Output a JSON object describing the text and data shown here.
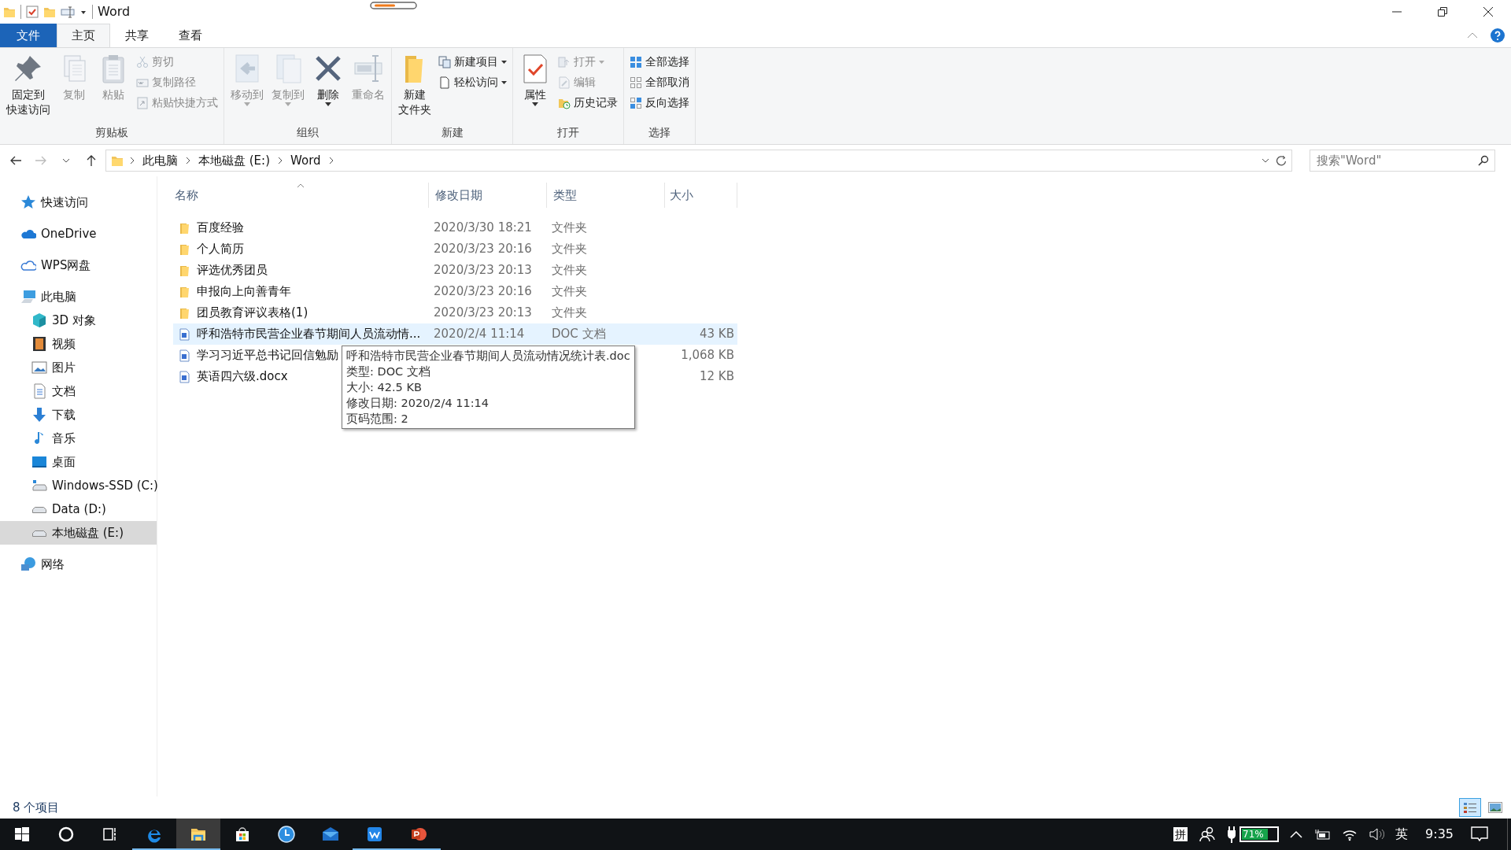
{
  "window": {
    "title": "Word"
  },
  "ribbon_tabs": [
    {
      "label": "文件",
      "kind": "file",
      "selected": false
    },
    {
      "label": "主页",
      "kind": "tab",
      "selected": true
    },
    {
      "label": "共享",
      "kind": "tab",
      "selected": false
    },
    {
      "label": "查看",
      "kind": "tab",
      "selected": false
    }
  ],
  "ribbon_groups": [
    {
      "label": "剪贴板",
      "items": [
        {
          "lines": [
            "固定到",
            "快速访问"
          ],
          "kind": "large",
          "disabled": false,
          "dropdown": false
        },
        {
          "lines": [
            "复制"
          ],
          "kind": "large",
          "disabled": true,
          "dropdown": false
        },
        {
          "lines": [
            "粘贴"
          ],
          "kind": "large",
          "disabled": true,
          "dropdown": false
        },
        {
          "lines": [
            "剪切"
          ],
          "kind": "small",
          "disabled": true,
          "dropdown": false
        },
        {
          "lines": [
            "复制路径"
          ],
          "kind": "small",
          "disabled": true,
          "dropdown": false
        },
        {
          "lines": [
            "粘贴快捷方式"
          ],
          "kind": "small",
          "disabled": true,
          "dropdown": false
        }
      ]
    },
    {
      "label": "组织",
      "items": [
        {
          "lines": [
            "移动到"
          ],
          "kind": "large",
          "disabled": true,
          "dropdown": true
        },
        {
          "lines": [
            "复制到"
          ],
          "kind": "large",
          "disabled": true,
          "dropdown": true
        },
        {
          "lines": [
            "删除"
          ],
          "kind": "large",
          "disabled": false,
          "dropdown": true
        },
        {
          "lines": [
            "重命名"
          ],
          "kind": "large",
          "disabled": true,
          "dropdown": false
        }
      ]
    },
    {
      "label": "新建",
      "items": [
        {
          "lines": [
            "新建",
            "文件夹"
          ],
          "kind": "large",
          "disabled": false,
          "dropdown": false
        },
        {
          "lines": [
            "新建项目"
          ],
          "kind": "small",
          "disabled": false,
          "dropdown": true
        },
        {
          "lines": [
            "轻松访问"
          ],
          "kind": "small",
          "disabled": false,
          "dropdown": true
        }
      ]
    },
    {
      "label": "打开",
      "items": [
        {
          "lines": [
            "属性"
          ],
          "kind": "large",
          "disabled": false,
          "dropdown": true
        },
        {
          "lines": [
            "打开"
          ],
          "kind": "small",
          "disabled": true,
          "dropdown": true
        },
        {
          "lines": [
            "编辑"
          ],
          "kind": "small",
          "disabled": true,
          "dropdown": false
        },
        {
          "lines": [
            "历史记录"
          ],
          "kind": "small",
          "disabled": false,
          "dropdown": false
        }
      ]
    },
    {
      "label": "选择",
      "items": [
        {
          "lines": [
            "全部选择"
          ],
          "kind": "small",
          "disabled": false,
          "dropdown": false
        },
        {
          "lines": [
            "全部取消"
          ],
          "kind": "small",
          "disabled": false,
          "dropdown": false
        },
        {
          "lines": [
            "反向选择"
          ],
          "kind": "small",
          "disabled": false,
          "dropdown": false
        }
      ]
    }
  ],
  "breadcrumb": [
    "此电脑",
    "本地磁盘 (E:)",
    "Word"
  ],
  "search": {
    "placeholder": "搜索\"Word\""
  },
  "sidebar": {
    "items": [
      {
        "label": "快速访问",
        "selected": false
      },
      {
        "label": "OneDrive",
        "selected": false
      },
      {
        "label": "WPS网盘",
        "selected": false
      },
      {
        "label": "此电脑",
        "selected": false,
        "children": [
          {
            "label": "3D 对象",
            "selected": false
          },
          {
            "label": "视频",
            "selected": false
          },
          {
            "label": "图片",
            "selected": false
          },
          {
            "label": "文档",
            "selected": false
          },
          {
            "label": "下载",
            "selected": false
          },
          {
            "label": "音乐",
            "selected": false
          },
          {
            "label": "桌面",
            "selected": false
          },
          {
            "label": "Windows-SSD (C:)",
            "selected": false
          },
          {
            "label": "Data (D:)",
            "selected": false
          },
          {
            "label": "本地磁盘 (E:)",
            "selected": true
          }
        ]
      },
      {
        "label": "网络",
        "selected": false
      }
    ]
  },
  "table": {
    "columns": [
      {
        "label": "名称",
        "sorted": true
      },
      {
        "label": "修改日期",
        "sorted": false
      },
      {
        "label": "类型",
        "sorted": false
      },
      {
        "label": "大小",
        "sorted": false
      }
    ],
    "rows": [
      {
        "name": "百度经验",
        "date": "2020/3/30 18:21",
        "type": "文件夹",
        "kind": "folder",
        "selected": false
      },
      {
        "name": "个人简历",
        "date": "2020/3/23 20:16",
        "type": "文件夹",
        "kind": "folder",
        "selected": false
      },
      {
        "name": "评选优秀团员",
        "date": "2020/3/23 20:13",
        "type": "文件夹",
        "kind": "folder",
        "selected": false
      },
      {
        "name": "申报向上向善青年",
        "date": "2020/3/23 20:16",
        "type": "文件夹",
        "kind": "folder",
        "selected": false
      },
      {
        "name": "团员教育评议表格(1)",
        "date": "2020/3/23 20:13",
        "type": "文件夹",
        "kind": "folder",
        "selected": false
      },
      {
        "name": "呼和浩特市民营企业春节期间人员流动情...",
        "date": "2020/2/4 11:14",
        "type": "DOC 文档",
        "size": "43 KB",
        "kind": "doc",
        "selected": true
      },
      {
        "name": "学习习近平总书记回信勉励",
        "size": "1,068 KB",
        "kind": "doc",
        "selected": false
      },
      {
        "name": "英语四六级.docx",
        "size": "12 KB",
        "kind": "doc",
        "selected": false
      }
    ]
  },
  "tooltip": {
    "lines": [
      "呼和浩特市民营企业春节期间人员流动情况统计表.doc",
      "类型: DOC 文档",
      "大小: 42.5 KB",
      "修改日期: 2020/2/4 11:14",
      "页码范围: 2"
    ]
  },
  "status_bar": {
    "count": "8 个项目",
    "views": [
      {
        "kind": "details",
        "selected": true
      },
      {
        "kind": "large-icons",
        "selected": false
      }
    ]
  },
  "taskbar": {
    "items": [
      {
        "kind": "start",
        "running": false,
        "selected": false
      },
      {
        "kind": "search",
        "running": false,
        "selected": false
      },
      {
        "kind": "task-view",
        "running": false,
        "selected": false
      },
      {
        "kind": "browser",
        "running": true,
        "selected": false
      },
      {
        "kind": "explorer",
        "running": true,
        "selected": true
      },
      {
        "kind": "store",
        "running": false,
        "selected": false
      },
      {
        "kind": "clock",
        "running": false,
        "selected": false
      },
      {
        "kind": "mail",
        "running": false,
        "selected": false
      },
      {
        "kind": "wps",
        "running": true,
        "selected": false
      },
      {
        "kind": "slides",
        "running": true,
        "selected": false
      }
    ],
    "ime": "拼",
    "battery": {
      "level": 0.71,
      "reading": "71%"
    },
    "language": "英",
    "time": "9:35"
  }
}
